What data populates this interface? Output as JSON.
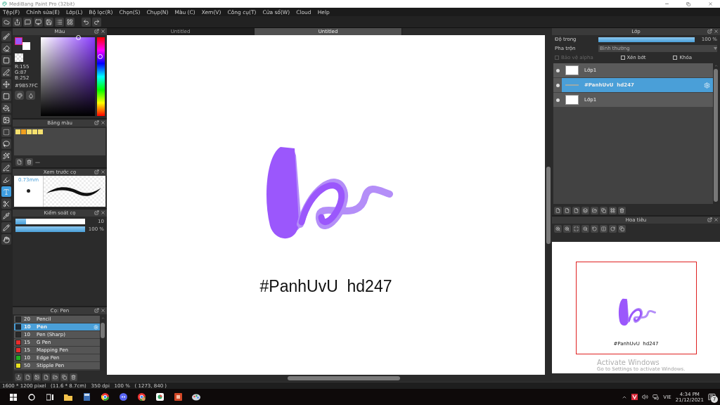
{
  "window": {
    "title": "MediBang Paint Pro (32bit)"
  },
  "menu": [
    "Tệp(F)",
    "Chỉnh sửa(E)",
    "Lớp(L)",
    "Bộ lọc(R)",
    "Chọn(S)",
    "Chụp(N)",
    "Màu (C)",
    "Xem(V)",
    "Công cụ(T)",
    "Cửa sổ(W)",
    "Cloud",
    "Help"
  ],
  "tools": [
    {
      "selected": false
    },
    {
      "selected": false
    },
    {
      "selected": false
    },
    {
      "selected": false
    },
    {
      "selected": false
    },
    {
      "selected": false
    },
    {
      "selected": false
    },
    {
      "selected": false
    },
    {
      "selected": false
    },
    {
      "selected": false
    },
    {
      "selected": false
    },
    {
      "selected": false
    },
    {
      "selected": false
    },
    {
      "selected": true
    },
    {
      "selected": false
    },
    {
      "selected": false
    },
    {
      "selected": false
    },
    {
      "selected": false
    }
  ],
  "color_panel": {
    "title": "Màu",
    "rgb": [
      "R:155",
      "G:87",
      "B:252"
    ],
    "hex": "#9B57FC"
  },
  "palette_panel": {
    "title": "Bảng màu",
    "swatches": [
      {
        "color": "#f5e06e"
      },
      {
        "color": "#f0a020"
      },
      {
        "color": "#f5e06e"
      },
      {
        "color": "#f5e06e"
      },
      {
        "color": "#f5e06e"
      }
    ],
    "separator": "—"
  },
  "brush_preview": {
    "title": "Xem trước cọ",
    "size": "0.73mm"
  },
  "brush_control": {
    "title": "Kiểm soát cọ",
    "sliders": [
      {
        "level": 0.15,
        "reading": "10"
      },
      {
        "level": 1,
        "reading": "100 %"
      }
    ]
  },
  "brush_list": {
    "title": "Cọ: Pen",
    "brushes": [
      {
        "size": "20",
        "name": "Pencil",
        "color": "#2a2a2a",
        "selected": false
      },
      {
        "size": "10",
        "name": "Pen",
        "color": "#1e2a36",
        "selected": true
      },
      {
        "size": "10",
        "name": "Pen (Sharp)",
        "color": "#2a2a2a",
        "selected": false
      },
      {
        "size": "15",
        "name": "G Pen",
        "color": "#e82c2c",
        "selected": false
      },
      {
        "size": "15",
        "name": "Mapping Pen",
        "color": "#e82c2c",
        "selected": false
      },
      {
        "size": "10",
        "name": "Edge Pen",
        "color": "#22b022",
        "selected": false
      },
      {
        "size": "50",
        "name": "Stipple Pen",
        "color": "#e8e020",
        "selected": false
      }
    ]
  },
  "canvas": {
    "tabs": [
      {
        "label": "Untitled",
        "selected": false
      },
      {
        "label": "Untitled",
        "selected": true
      }
    ],
    "text": "#PanhUvU  hd247"
  },
  "layer_panel": {
    "title": "Lớp",
    "opacity_label": "Độ trong",
    "opacity": {
      "level": 1
    },
    "opacity_reading": "100 %",
    "blend_label": "Pha trộn",
    "blend_value": "Bình thường",
    "options": [
      {
        "label": "Bảo vệ alpha",
        "checked": false,
        "disabled": true
      },
      {
        "label": "Xén bớt",
        "checked": false,
        "disabled": false
      },
      {
        "label": "Khóa",
        "checked": false,
        "disabled": false
      }
    ],
    "layers": [
      {
        "name": "Lớp1",
        "selected": false,
        "kind": "image"
      },
      {
        "name": "#PanhUvU  hd247",
        "selected": true,
        "kind": "text"
      },
      {
        "name": "Lớp1",
        "selected": false,
        "kind": "image"
      }
    ]
  },
  "navigator": {
    "title": "Hoa tiêu",
    "text": "#PanhUvU  hd247",
    "overlay": [
      "Activate Windows",
      "Go to Settings to activate Windows."
    ]
  },
  "status_bar": "1600 * 1200 pixel   (11.6 * 8.7cm)   350 dpi   100 %   ( 1273, 840 )",
  "taskbar": {
    "language": "VIE",
    "time": "4:34 PM",
    "date": "21/12/2021",
    "notifications": "7"
  }
}
